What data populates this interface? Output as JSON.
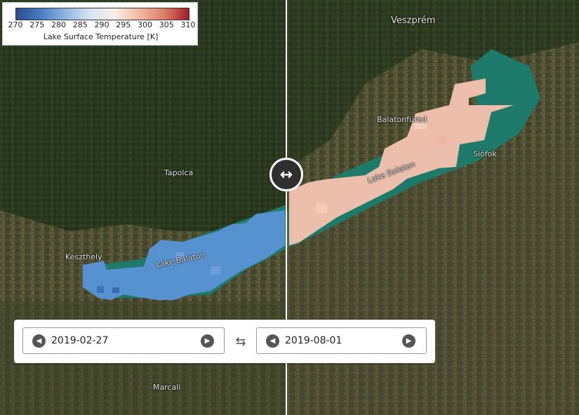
{
  "legend": {
    "ticks": [
      "270",
      "275",
      "280",
      "285",
      "290",
      "295",
      "300",
      "305",
      "310"
    ],
    "title": "Lake Surface Temperature [K]",
    "colors": [
      "#2b4d8f",
      "#4a7cc0",
      "#8fb5e0",
      "#d7e5f3",
      "#f7efe9",
      "#f1b9a0",
      "#dd7f69",
      "#a11d2b"
    ]
  },
  "places": [
    {
      "key": "veszprem",
      "name": "Veszprém"
    },
    {
      "key": "tapolca",
      "name": "Tapolca"
    },
    {
      "key": "balatonfured",
      "name": "Balatonfüred"
    },
    {
      "key": "siofok",
      "name": "Siófok"
    },
    {
      "key": "keszthely",
      "name": "Keszthely"
    },
    {
      "key": "lake-left",
      "name": "Lake Balaton"
    },
    {
      "key": "lake-right",
      "name": "Lake Balaton"
    },
    {
      "key": "marcali",
      "name": "Marcali"
    }
  ],
  "compare": {
    "left_date": "2019-02-27",
    "right_date": "2019-08-01"
  },
  "icons": {
    "split_handle": "left-right-arrow-icon",
    "prev": "chevron-left-icon",
    "next": "chevron-right-icon",
    "swap": "swap-icon"
  },
  "overlay_colors": {
    "left_lake": "#5b93d6",
    "right_lake": "#f2c1ae",
    "water": "#1e7a6a"
  }
}
